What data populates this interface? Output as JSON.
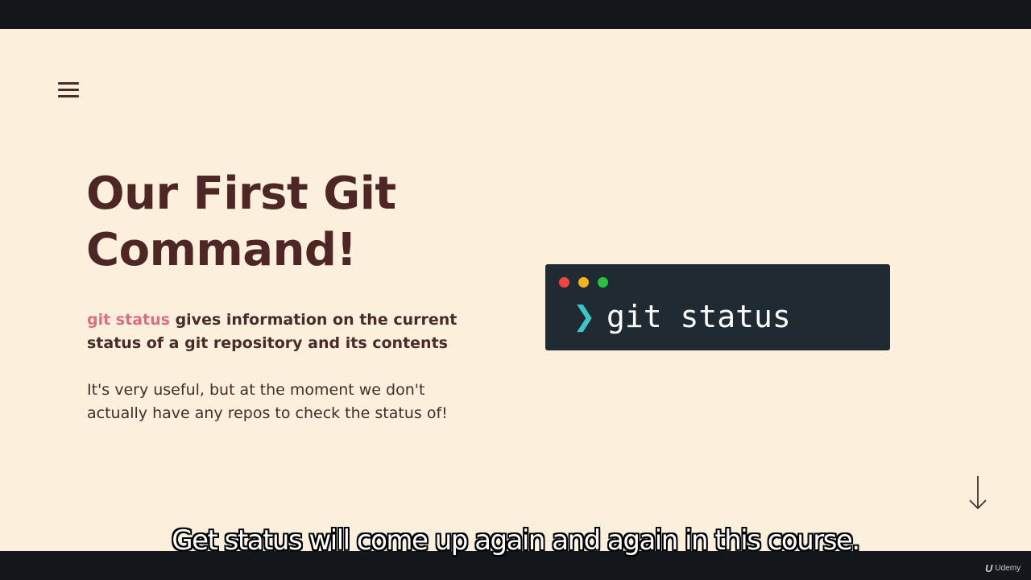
{
  "menu": {
    "icon": "hamburger-menu-icon"
  },
  "slide": {
    "title_line1": "Our First Git",
    "title_line2": "Command!",
    "desc_code": "git status",
    "desc_line1_rest": " gives information on the current",
    "desc_line2": "status of a git repository and its contents",
    "note_line1": "It's very useful, but at the moment we don't",
    "note_line2": "actually have any repos to check the status of!"
  },
  "terminal": {
    "prompt": "❯",
    "command": "git status",
    "window_buttons": [
      "red",
      "yellow",
      "green"
    ]
  },
  "nav": {
    "next_icon": "arrow-down-icon"
  },
  "caption": "Get status will come up again and again in this course.",
  "brand": {
    "logo": "U",
    "name": "Udemy"
  },
  "colors": {
    "background": "#fcefdc",
    "heading": "#4f2626",
    "accent": "#dc6e84",
    "terminal_bg": "#202a32",
    "prompt": "#3fc3c7"
  }
}
